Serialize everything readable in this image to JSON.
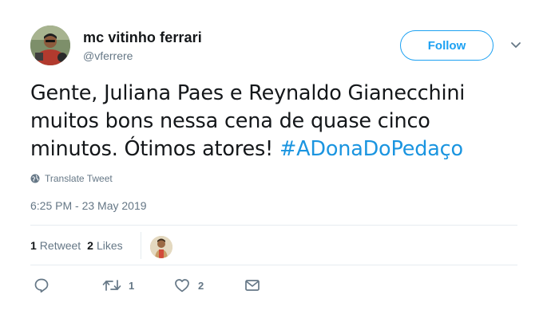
{
  "author": {
    "display_name": "mc vitinho ferrari",
    "handle": "@vferrere"
  },
  "follow_label": "Follow",
  "tweet": {
    "lines": [
      "Gente, Juliana Paes e Reynaldo Gianecchini",
      "muitos bons nessa cena de quase cinco",
      "minutos. Ótimos atores!"
    ],
    "hashtag": "#ADonaDoPedaço"
  },
  "translate_label": "Translate Tweet",
  "timestamp": "6:25 PM - 23 May 2019",
  "stats": {
    "retweets_count": "1",
    "retweets_label": "Retweet",
    "likes_count": "2",
    "likes_label": "Likes"
  },
  "actions": {
    "retweet_count": "1",
    "like_count": "2"
  },
  "colors": {
    "accent": "#1da1f2",
    "hashtag": "#1b95e0",
    "muted": "#657786",
    "text": "#14171a",
    "divider": "#e6ecf0"
  },
  "icons": [
    "avatar",
    "chevron-down-icon",
    "globe-icon",
    "reply-icon",
    "retweet-icon",
    "heart-icon",
    "envelope-icon"
  ]
}
